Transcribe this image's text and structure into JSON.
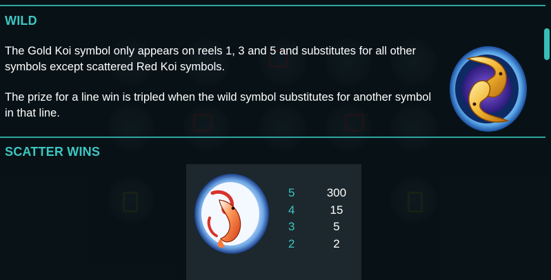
{
  "wild": {
    "title": "WILD",
    "paragraph1": "The Gold Koi symbol only appears on reels 1, 3 and 5 and substitutes for all other symbols except scattered Red Koi symbols.",
    "paragraph2": "The prize for a line win is tripled when the wild symbol substitutes for another symbol in that line.",
    "symbol_icon": "gold-koi-icon"
  },
  "scatter": {
    "title": "SCATTER WINS",
    "symbol_icon": "red-koi-icon",
    "paytable": [
      {
        "count": "5",
        "payout": "300"
      },
      {
        "count": "4",
        "payout": "15"
      },
      {
        "count": "3",
        "payout": "5"
      },
      {
        "count": "2",
        "payout": "2"
      }
    ]
  },
  "colors": {
    "accent": "#3ec6c2",
    "rule": "#2fa7a4",
    "text": "#ffffff",
    "background": "#0b1419"
  }
}
